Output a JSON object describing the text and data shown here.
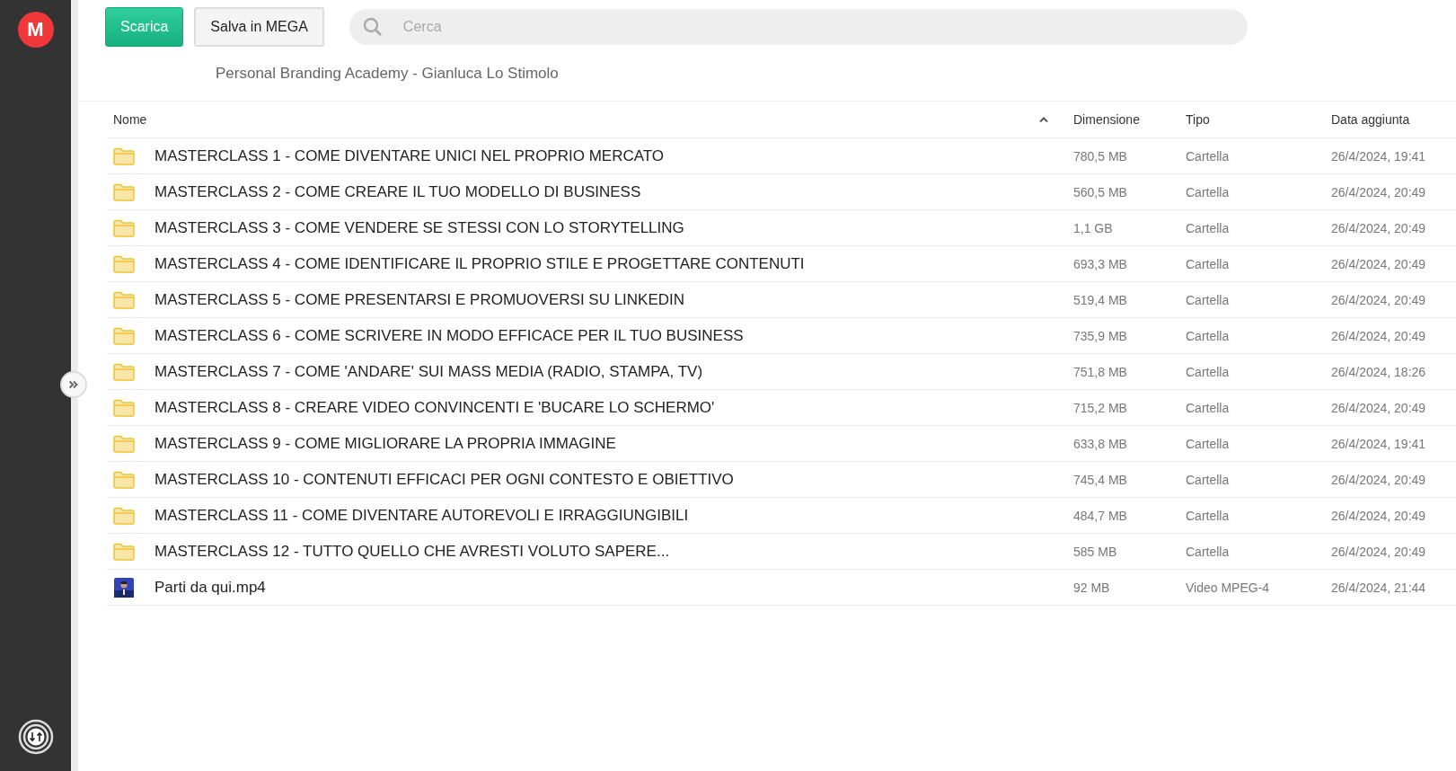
{
  "sidebar": {
    "logo_letter": "M"
  },
  "toolbar": {
    "buttons": [
      {
        "label": "Scarica",
        "kind": "primary"
      },
      {
        "label": "Salva in MEGA",
        "kind": "secondary"
      }
    ],
    "search": {
      "placeholder": "Cerca"
    }
  },
  "folder_title": "Personal Branding Academy - Gianluca Lo Stimolo",
  "table": {
    "columns": [
      "Nome",
      "Dimensione",
      "Tipo",
      "Data aggiunta"
    ],
    "sort_ascending": true,
    "rows": [
      {
        "kind": "folder",
        "name": "MASTERCLASS 1 - COME DIVENTARE UNICI NEL PROPRIO MERCATO",
        "size": "780,5 MB",
        "type": "Cartella",
        "date": "26/4/2024, 19:41"
      },
      {
        "kind": "folder",
        "name": "MASTERCLASS 2 - COME CREARE IL TUO MODELLO DI BUSINESS",
        "size": "560,5 MB",
        "type": "Cartella",
        "date": "26/4/2024, 20:49"
      },
      {
        "kind": "folder",
        "name": "MASTERCLASS 3 - COME VENDERE SE STESSI CON LO STORYTELLING",
        "size": "1,1 GB",
        "type": "Cartella",
        "date": "26/4/2024, 20:49"
      },
      {
        "kind": "folder",
        "name": "MASTERCLASS 4 - COME IDENTIFICARE IL PROPRIO STILE E PROGETTARE CONTENUTI",
        "size": "693,3 MB",
        "type": "Cartella",
        "date": "26/4/2024, 20:49"
      },
      {
        "kind": "folder",
        "name": "MASTERCLASS 5 - COME PRESENTARSI E PROMUOVERSI SU LINKEDIN",
        "size": "519,4 MB",
        "type": "Cartella",
        "date": "26/4/2024, 20:49"
      },
      {
        "kind": "folder",
        "name": "MASTERCLASS 6 - COME SCRIVERE IN MODO EFFICACE PER IL TUO BUSINESS",
        "size": "735,9 MB",
        "type": "Cartella",
        "date": "26/4/2024, 20:49"
      },
      {
        "kind": "folder",
        "name": "MASTERCLASS 7 - COME 'ANDARE' SUI MASS MEDIA (RADIO, STAMPA, TV)",
        "size": "751,8 MB",
        "type": "Cartella",
        "date": "26/4/2024, 18:26"
      },
      {
        "kind": "folder",
        "name": "MASTERCLASS 8 - CREARE VIDEO CONVINCENTI E 'BUCARE LO SCHERMO'",
        "size": "715,2 MB",
        "type": "Cartella",
        "date": "26/4/2024, 20:49"
      },
      {
        "kind": "folder",
        "name": "MASTERCLASS 9 - COME MIGLIORARE LA PROPRIA IMMAGINE",
        "size": "633,8 MB",
        "type": "Cartella",
        "date": "26/4/2024, 19:41"
      },
      {
        "kind": "folder",
        "name": "MASTERCLASS 10 - CONTENUTI EFFICACI PER OGNI CONTESTO E OBIETTIVO",
        "size": "745,4 MB",
        "type": "Cartella",
        "date": "26/4/2024, 20:49"
      },
      {
        "kind": "folder",
        "name": "MASTERCLASS 11 - COME DIVENTARE AUTOREVOLI E IRRAGGIUNGIBILI",
        "size": "484,7 MB",
        "type": "Cartella",
        "date": "26/4/2024, 20:49"
      },
      {
        "kind": "folder",
        "name": "MASTERCLASS 12 - TUTTO QUELLO CHE AVRESTI VOLUTO SAPERE...",
        "size": "585 MB",
        "type": "Cartella",
        "date": "26/4/2024, 20:49"
      },
      {
        "kind": "video",
        "name": "Parti da qui.mp4",
        "size": "92 MB",
        "type": "Video MPEG-4",
        "date": "26/4/2024, 21:44"
      }
    ]
  }
}
